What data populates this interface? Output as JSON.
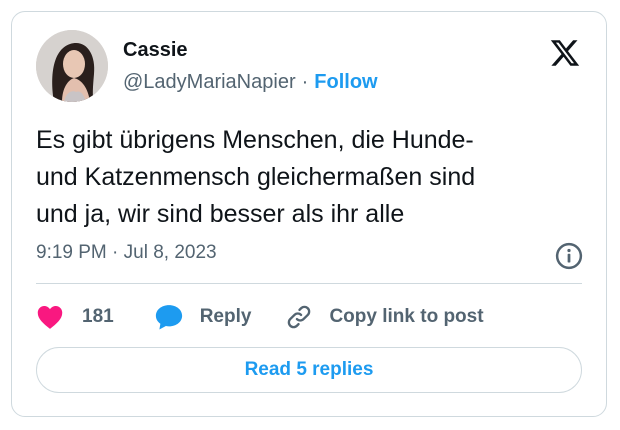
{
  "author": {
    "name": "Cassie",
    "handle": "@LadyMariaNapier",
    "separator": "·",
    "follow_label": "Follow"
  },
  "tweet": {
    "text": "Es gibt übrigens Menschen, die Hunde-\nund Katzenmensch gleichermaßen sind\nund ja, wir sind besser als ihr alle",
    "timestamp": "9:19 PM · Jul 8, 2023"
  },
  "actions": {
    "like_count": "181",
    "reply_label": "Reply",
    "copy_link_label": "Copy link to post"
  },
  "read_replies_label": "Read 5 replies",
  "icons": {
    "brand": "x-logo-icon",
    "info": "info-icon",
    "like": "heart-icon",
    "reply": "speech-bubble-icon",
    "copy_link": "link-icon"
  },
  "colors": {
    "accent": "#1d9bf0",
    "like": "#f91880",
    "text_primary": "#0f1419",
    "text_secondary": "#536471",
    "border": "#cfd9de"
  }
}
